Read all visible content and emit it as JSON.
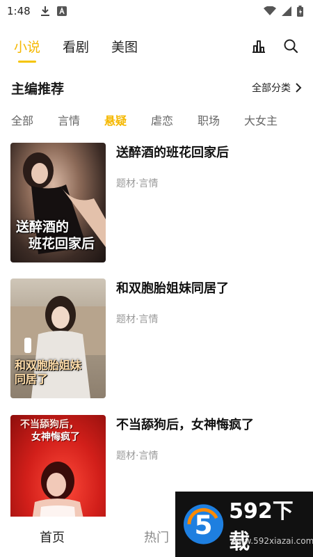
{
  "status": {
    "time": "1:48"
  },
  "top_tabs": [
    {
      "label": "小说",
      "active": true
    },
    {
      "label": "看剧",
      "active": false
    },
    {
      "label": "美图",
      "active": false
    }
  ],
  "section": {
    "title": "主编推荐",
    "more_label": "全部分类"
  },
  "categories": [
    {
      "label": "全部",
      "active": false
    },
    {
      "label": "言情",
      "active": false
    },
    {
      "label": "悬疑",
      "active": true
    },
    {
      "label": "虐恋",
      "active": false
    },
    {
      "label": "职场",
      "active": false
    },
    {
      "label": "大女主",
      "active": false
    }
  ],
  "books": [
    {
      "title": "送醉酒的班花回家后",
      "tags": "题材·言情",
      "cover_text_1": "送醉酒的",
      "cover_text_2": "班花回家后"
    },
    {
      "title": "和双胞胎姐妹同居了",
      "tags": "题材·言情",
      "cover_text_1": "和双胞胎姐妹",
      "cover_text_2": "同居了"
    },
    {
      "title": "不当舔狗后，女神悔疯了",
      "tags": "题材·言情",
      "cover_text_1": "不当舔狗后，",
      "cover_text_2": "女神悔疯了"
    }
  ],
  "bottom_nav": [
    {
      "label": "首页"
    },
    {
      "label": "热门"
    }
  ],
  "watermark": {
    "logo_digit": "5",
    "brand": "592下载",
    "url": "www.592xiazai.com"
  },
  "colors": {
    "accent": "#f5b800"
  }
}
